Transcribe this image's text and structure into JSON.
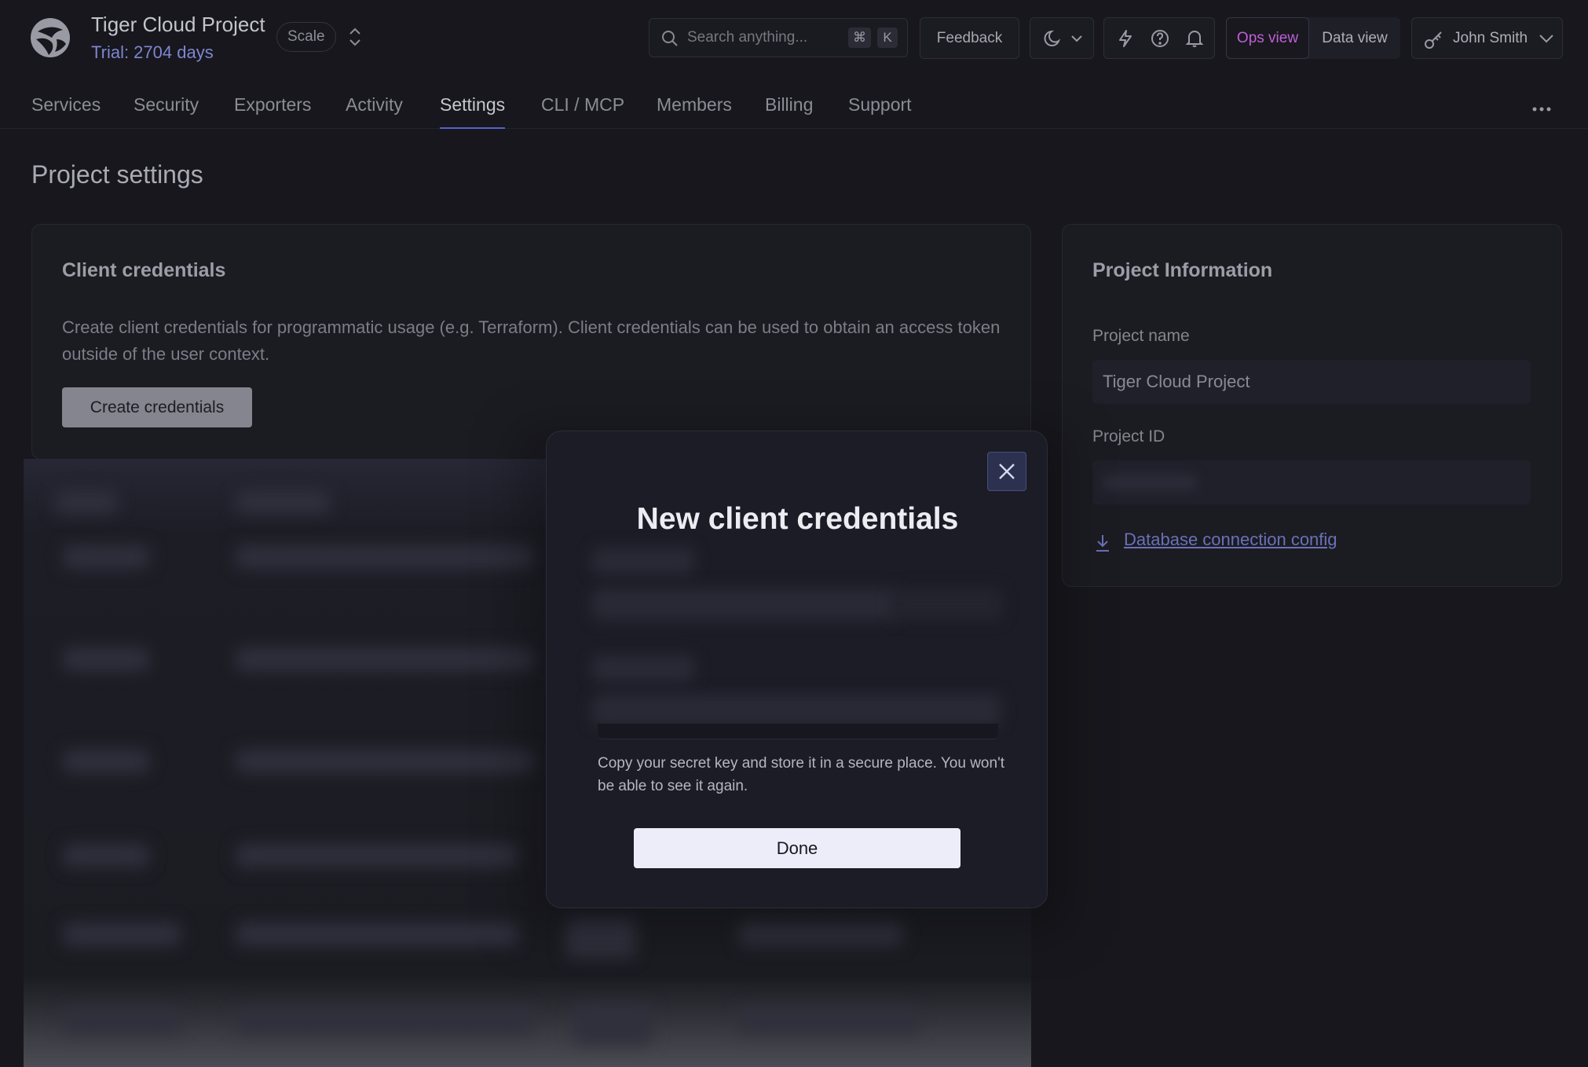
{
  "header": {
    "project_title": "Tiger Cloud Project",
    "trial": "Trial: 2704 days",
    "plan": "Scale",
    "search_placeholder": "Search anything...",
    "kbd_cmd": "⌘",
    "kbd_k": "K",
    "feedback_label": "Feedback",
    "ops_view_label": "Ops view",
    "data_view_label": "Data view",
    "user_name": "John Smith"
  },
  "nav": {
    "tabs": [
      {
        "label": "Services"
      },
      {
        "label": "Security"
      },
      {
        "label": "Exporters"
      },
      {
        "label": "Activity"
      },
      {
        "label": "Settings"
      },
      {
        "label": "CLI / MCP"
      },
      {
        "label": "Members"
      },
      {
        "label": "Billing"
      },
      {
        "label": "Support"
      }
    ],
    "active_tab": "Settings"
  },
  "page": {
    "title": "Project settings"
  },
  "client_credentials": {
    "heading": "Client credentials",
    "description": "Create client credentials for programmatic usage (e.g. Terraform). Client credentials can be used to obtain an access token outside of the user context.",
    "create_button": "Create credentials"
  },
  "project_info": {
    "heading": "Project Information",
    "name_label": "Project name",
    "name_value": "Tiger Cloud Project",
    "id_label": "Project ID",
    "download_link": "Database connection config"
  },
  "modal": {
    "title": "New client credentials",
    "note": "Copy your secret key and store it in a secure place. You won't be able to see it again.",
    "done_button": "Done"
  },
  "colors": {
    "background": "#17171d",
    "accent": "#5561c6",
    "ops_view": "#c05fd8",
    "trial": "#7f86cf"
  }
}
